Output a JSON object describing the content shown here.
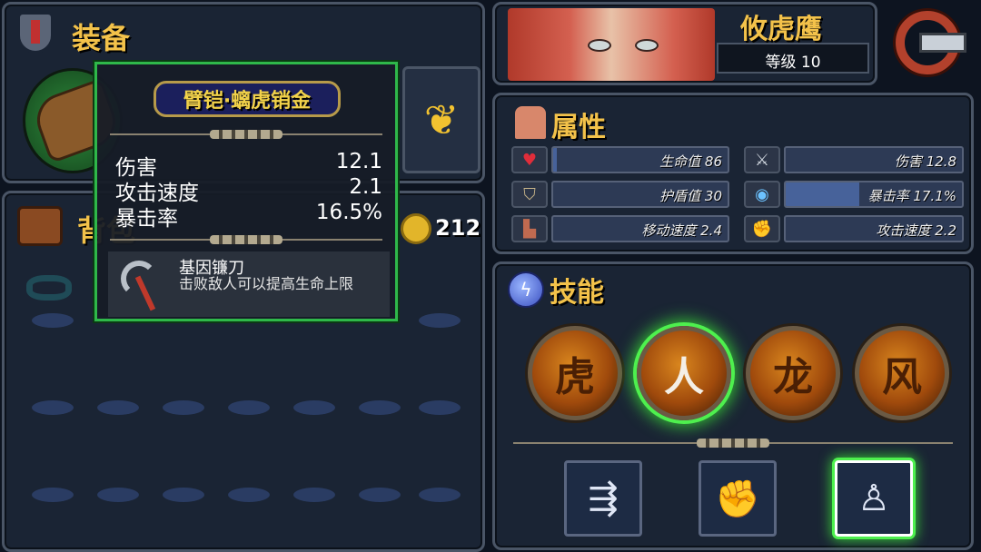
{
  "equipment": {
    "title": "装备"
  },
  "backpack": {
    "title": "背包",
    "coins": "212"
  },
  "tooltip": {
    "item_name": "臂铠·螭虎销金",
    "stats": [
      {
        "label": "伤害",
        "value": "12.1"
      },
      {
        "label": "攻击速度",
        "value": "2.1"
      },
      {
        "label": "暴击率",
        "value": "16.5%"
      }
    ],
    "perk": {
      "name": "基因镰刀",
      "desc": "击败敌人可以提高生命上限"
    }
  },
  "character": {
    "name": "攸虎鹰",
    "level_text": "等级 10"
  },
  "attributes": {
    "title": "属性",
    "stats": [
      {
        "label": "生命值 86",
        "icon": "heart-icon",
        "fill": 0.02
      },
      {
        "label": "伤害 12.8",
        "icon": "sword-icon",
        "fill": 0.0
      },
      {
        "label": "护盾值 30",
        "icon": "shield-icon",
        "fill": 0.0
      },
      {
        "label": "暴击率 17.1%",
        "icon": "eye-icon",
        "fill": 0.42
      },
      {
        "label": "移动速度 2.4",
        "icon": "boot-icon",
        "fill": 0.0
      },
      {
        "label": "攻击速度 2.2",
        "icon": "fist-icon",
        "fill": 0.0
      }
    ]
  },
  "skills": {
    "title": "技能",
    "orbs": [
      {
        "glyph": "虎",
        "active": false
      },
      {
        "glyph": "人",
        "active": true
      },
      {
        "glyph": "龙",
        "active": false
      },
      {
        "glyph": "风",
        "active": false
      }
    ]
  },
  "colors": {
    "accent_gold": "#f3c24a",
    "select_green": "#4ef04e",
    "panel": "#1a2434"
  }
}
